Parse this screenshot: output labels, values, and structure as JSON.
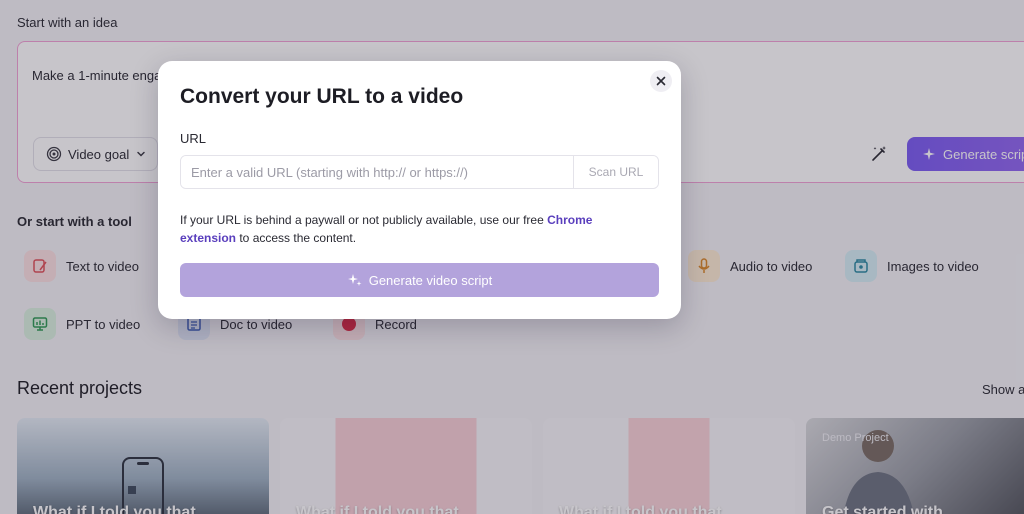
{
  "background": {
    "idea": {
      "label": "Start with an idea",
      "prompt_value": "Make a 1-minute enga",
      "goal_select": "Video goal",
      "generate_label": "Generate scrip"
    },
    "tools": {
      "label": "Or start with a tool",
      "items": [
        {
          "label": "Text to video",
          "icon": "text-to-video-icon"
        },
        {
          "label": "Audio to video",
          "icon": "microphone-icon"
        },
        {
          "label": "Images to video",
          "icon": "images-icon"
        },
        {
          "label": "PPT to video",
          "icon": "presentation-icon"
        },
        {
          "label": "Doc to video",
          "icon": "document-icon"
        },
        {
          "label": "Record",
          "icon": "record-icon"
        }
      ]
    },
    "recent": {
      "title": "Recent projects",
      "show_all": "Show a",
      "cards": [
        {
          "title": "What if I told you that"
        },
        {
          "title": "What if I told you that"
        },
        {
          "title": "What if I told you that"
        },
        {
          "badge": "Demo Project",
          "title": "Get started with"
        }
      ]
    }
  },
  "modal": {
    "title": "Convert your URL to a video",
    "url_label": "URL",
    "url_placeholder": "Enter a valid URL (starting with http:// or https://)",
    "url_value": "",
    "scan_label": "Scan URL",
    "note": {
      "before": "If your URL is behind a paywall or not publicly available, use our free ",
      "link": "Chrome extension",
      "after": " to access the content."
    },
    "generate_label": "Generate video script"
  },
  "colors": {
    "accent": "#7a5cf2",
    "link": "#5a3fbd",
    "disabled_button": "#b3a3dc",
    "highlight_border": "#f2a2d5"
  }
}
